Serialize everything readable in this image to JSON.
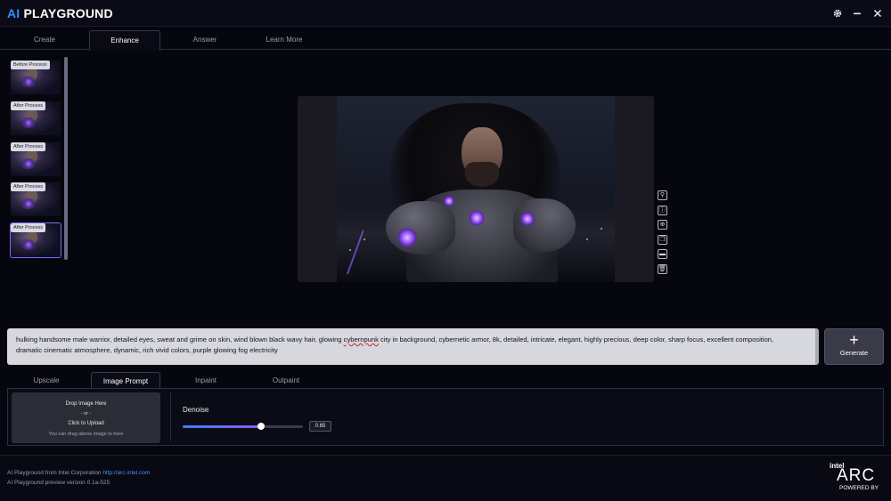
{
  "app": {
    "logo_ai": "AI",
    "logo_rest": "PLAYGROUND"
  },
  "window_controls": {
    "settings_icon": "gear-icon",
    "minimize_icon": "minimize-icon",
    "close_icon": "close-icon"
  },
  "top_tabs": [
    {
      "label": "Create"
    },
    {
      "label": "Enhance",
      "active": true
    },
    {
      "label": "Answer"
    },
    {
      "label": "Learn More"
    }
  ],
  "thumbnails": [
    {
      "label": "Before Process"
    },
    {
      "label": "After Process"
    },
    {
      "label": "After Process"
    },
    {
      "label": "After Process"
    },
    {
      "label": "After Process",
      "selected": true
    }
  ],
  "preview_actions": [
    "user-icon",
    "info-icon",
    "zoom-icon",
    "copy-icon",
    "folder-icon",
    "trash-icon"
  ],
  "prompt": {
    "text_before": "hulking handsome male warrior, detailed eyes, sweat and grime on skin, wind blown black wavy hair, glowing ",
    "text_misspelled": "cybernpunk",
    "text_after": " city in background, cybernetic armor, 8k, detailed, intricate, elegant, highly precious, deep color, sharp focus, excellent composition, dramatic cinematic atmosphere, dynamic, rich vivid colors, purple glowing fog electricity"
  },
  "generate_label": "Generate",
  "sub_tabs": [
    {
      "label": "Upscale"
    },
    {
      "label": "Image Prompt",
      "active": true
    },
    {
      "label": "Inpaint"
    },
    {
      "label": "Outpaint"
    }
  ],
  "drop_zone": {
    "line1": "Drop Image Here",
    "line2": "- or -",
    "line3": "Click to Upload",
    "line4": "You can drag above image to here"
  },
  "denoise": {
    "label": "Denoise",
    "value": 0.65,
    "value_text": "0.65"
  },
  "footer": {
    "line1_prefix": "AI Playground from Intel Corporation",
    "link": "http://arc.intel.com",
    "line2": "AI Playground preview version 0.1a-525"
  },
  "brand": {
    "intel": "intel",
    "arc": "ARC",
    "powered": "POWERED BY"
  },
  "colors": {
    "accent": "#2f8cff",
    "slider_start": "#3f7dff",
    "slider_end": "#8a5cff",
    "glow": "#a15cff"
  }
}
